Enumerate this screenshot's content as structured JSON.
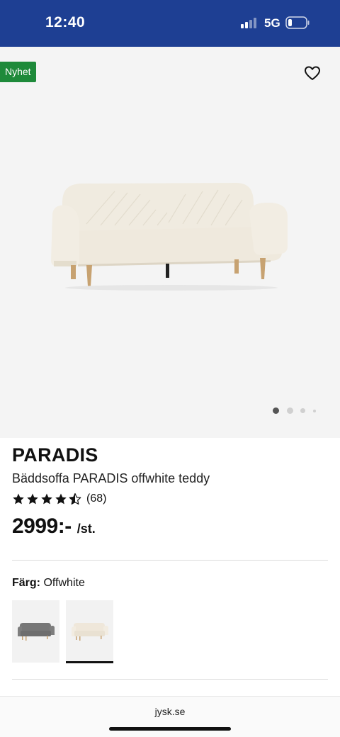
{
  "status_bar": {
    "time": "12:40",
    "network": "5G",
    "background": "#1e3f93"
  },
  "gallery": {
    "badge": "Nyhet",
    "badge_color": "#1e8a3a",
    "wishlist_icon": "heart-outline-icon",
    "image_count": 4,
    "active_image_index": 0
  },
  "product": {
    "brand": "PARADIS",
    "title": "Bäddsoffa PARADIS offwhite teddy",
    "rating": 4.5,
    "review_count": "(68)",
    "price": "2999:-",
    "unit": "/st."
  },
  "color_selector": {
    "label": "Färg:",
    "value": "Offwhite",
    "options": [
      {
        "name": "Grå",
        "selected": false,
        "color": "#7a7a7a"
      },
      {
        "name": "Offwhite",
        "selected": true,
        "color": "#efe7da"
      }
    ]
  },
  "browser": {
    "url": "jysk.se"
  }
}
